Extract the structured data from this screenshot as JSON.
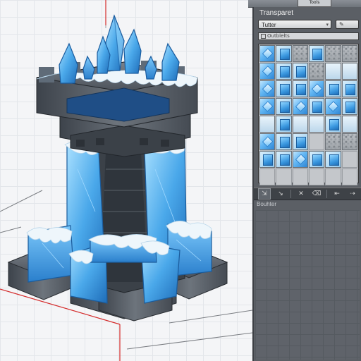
{
  "header": {
    "tab_label": "Tools"
  },
  "panel": {
    "title": "Transparet",
    "tileset_select": "Tutter",
    "sub_row_label": "Outblelts",
    "tool_button_icon": "pencil-icon",
    "tiles": [
      "ice",
      "cube",
      "stone",
      "cube",
      "stone",
      "stone",
      "ice",
      "cube",
      "cube",
      "stone",
      "frost",
      "frost",
      "ice",
      "cube",
      "cube",
      "ice",
      "cube",
      "cube",
      "ice",
      "cube",
      "ice",
      "cube",
      "ice",
      "cube",
      "frost",
      "cube",
      "frost",
      "frost",
      "cube",
      "frost",
      "ice",
      "cube",
      "cube",
      "empty",
      "stone",
      "stone",
      "cube",
      "cube",
      "ice",
      "cube",
      "cube",
      "empty",
      "empty",
      "empty",
      "empty",
      "empty",
      "empty",
      "empty"
    ]
  },
  "toolbar": {
    "tools": [
      {
        "name": "stamp-icon",
        "glyph": "⇲",
        "active": true
      },
      {
        "name": "brush-icon",
        "glyph": "↘",
        "active": false
      },
      {
        "name": "cross-icon",
        "glyph": "✕",
        "active": false
      },
      {
        "name": "eraser-icon",
        "glyph": "⌫",
        "active": false
      },
      {
        "name": "fill-icon",
        "glyph": "⇤",
        "active": false
      },
      {
        "name": "picker-icon",
        "glyph": "⇢",
        "active": false
      }
    ]
  },
  "layers": {
    "label": "Bouhter"
  },
  "colors": {
    "ice_light": "#8fd4ff",
    "ice_mid": "#3f9de4",
    "ice_dark": "#1f6fb8",
    "stone_light": "#6e757e",
    "stone_dark": "#3b4148",
    "snow": "#eef6fb",
    "axis_red": "#d42b2b"
  }
}
